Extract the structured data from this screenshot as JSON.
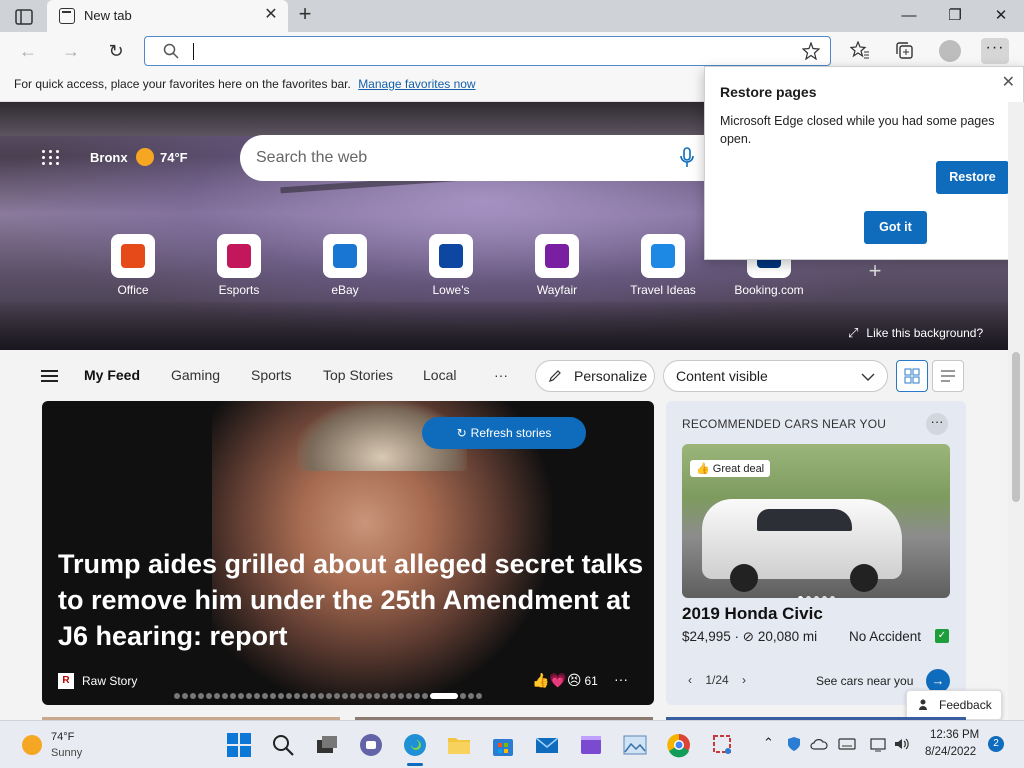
{
  "browser": {
    "tab_title": "New tab",
    "favorites_bar_text": "For quick access, place your favorites here on the favorites bar.",
    "favorites_bar_link": "Manage favorites now"
  },
  "hero": {
    "location": "Bronx",
    "temperature": "74°F",
    "search_placeholder": "Search the web",
    "quick_links": [
      {
        "label": "Office",
        "color": "#e64a19"
      },
      {
        "label": "Esports",
        "color": "#c2185b"
      },
      {
        "label": "eBay",
        "color": "#1976d2"
      },
      {
        "label": "Lowe's",
        "color": "#0d47a1"
      },
      {
        "label": "Wayfair",
        "color": "#7b1fa2"
      },
      {
        "label": "Travel Ideas",
        "color": "#1e88e5"
      },
      {
        "label": "Booking.com",
        "color": "#003580"
      }
    ],
    "add_glyph": "+",
    "like_background": "Like this background?"
  },
  "popup": {
    "title": "Restore pages",
    "message": "Microsoft Edge closed while you had some pages open.",
    "restore_label": "Restore",
    "got_it_label": "Got it"
  },
  "feed": {
    "tabs": [
      "My Feed",
      "Gaming",
      "Sports",
      "Top Stories",
      "Local"
    ],
    "more_glyph": "···",
    "personalize_label": "Personalize",
    "content_visibility": "Content visible"
  },
  "story": {
    "refresh_label": "Refresh stories",
    "headline": "Trump aides grilled about alleged secret talks to remove him under the 25th Amendment at J6 hearing: report",
    "source": "Raw Story",
    "source_logo": "R",
    "reaction_count": "61",
    "reactions": "👍💗😣"
  },
  "car_card": {
    "header": "RECOMMENDED CARS NEAR YOU",
    "deal_badge": "Great deal",
    "name": "2019 Honda Civic",
    "price_mileage": "$24,995 · ⊘ 20,080 mi",
    "condition": "No Accident",
    "pager": "1/24",
    "see_cars": "See cars near you"
  },
  "feedback_label": "Feedback",
  "taskbar": {
    "weather_temp": "74°F",
    "weather_condition": "Sunny",
    "time": "12:36 PM",
    "date": "8/24/2022",
    "notification_count": "2"
  }
}
